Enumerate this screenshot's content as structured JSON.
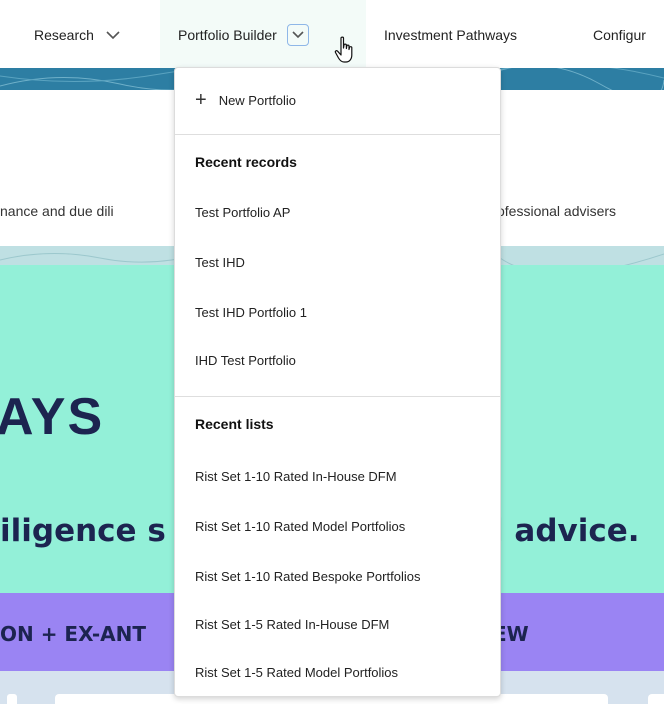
{
  "nav": {
    "research": "Research",
    "portfolio_builder": "Portfolio Builder",
    "investment_pathways": "Investment Pathways",
    "configure": "Configur"
  },
  "page": {
    "subtext_left": "nance and due dili",
    "subtext_right": "ofessional advisers",
    "hero_title": "AYS",
    "hero_sub_left": "iligence s",
    "hero_sub_right": "l advice.",
    "strip_left": "ON + EX-ANT",
    "strip_right": "EW"
  },
  "menu": {
    "new_item": "New Portfolio",
    "recent_records_heading": "Recent records",
    "recent_records": [
      "Test Portfolio AP",
      "Test IHD",
      "Test IHD Portfolio 1",
      "IHD Test Portfolio"
    ],
    "recent_lists_heading": "Recent lists",
    "recent_lists": [
      "Rist Set 1-10 Rated In-House DFM",
      "Rist Set 1-10 Rated Model Portfolios",
      "Rist Set 1-10 Rated Bespoke Portfolios",
      "Rist Set 1-5 Rated In-House DFM",
      "Rist Set 1-5 Rated Model Portfolios"
    ]
  },
  "colors": {
    "teal_hero": "#93f0d8",
    "purple_strip": "#9a84f3",
    "navy_text": "#1c2450",
    "band": "#2d7ea3"
  },
  "icons": [
    "chevron-down-icon",
    "plus-icon",
    "hand-pointer-cursor-icon"
  ]
}
